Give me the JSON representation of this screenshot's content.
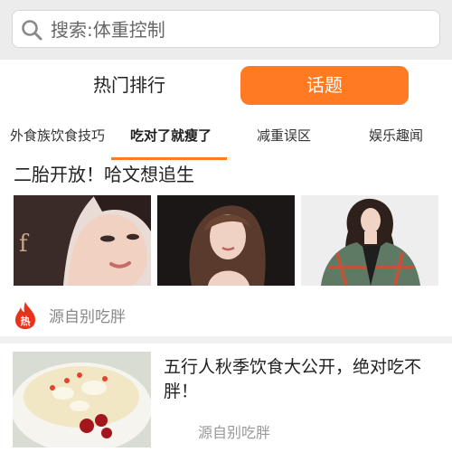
{
  "search": {
    "text": "搜索:体重控制",
    "icon": "search-icon"
  },
  "top_tabs": [
    {
      "label": "热门排行",
      "active": false
    },
    {
      "label": "话题",
      "active": true
    }
  ],
  "sub_tabs": [
    {
      "label": "外食族饮食技巧",
      "active": false
    },
    {
      "label": "吃对了就瘦了",
      "active": true
    },
    {
      "label": "减重误区",
      "active": false
    },
    {
      "label": "娱乐趣闻",
      "active": false
    }
  ],
  "feature": {
    "headline": "二胎开放！哈文想追生",
    "images": [
      "woman-portrait-photo",
      "woman-long-hair-photo",
      "woman-plaid-coat-photo"
    ],
    "badge": {
      "label": "热",
      "icon": "flame-hot-icon"
    },
    "source": "源自别吃胖"
  },
  "article": {
    "title": "五行人秋季饮食大公开，绝对吃不胖！",
    "image": "porridge-bowl-photo",
    "source": "源自别吃胖"
  },
  "colors": {
    "accent": "#ff7a22",
    "hot_red": "#e8331c",
    "search_bg": "#ececec",
    "divider": "#f0f0f0"
  }
}
